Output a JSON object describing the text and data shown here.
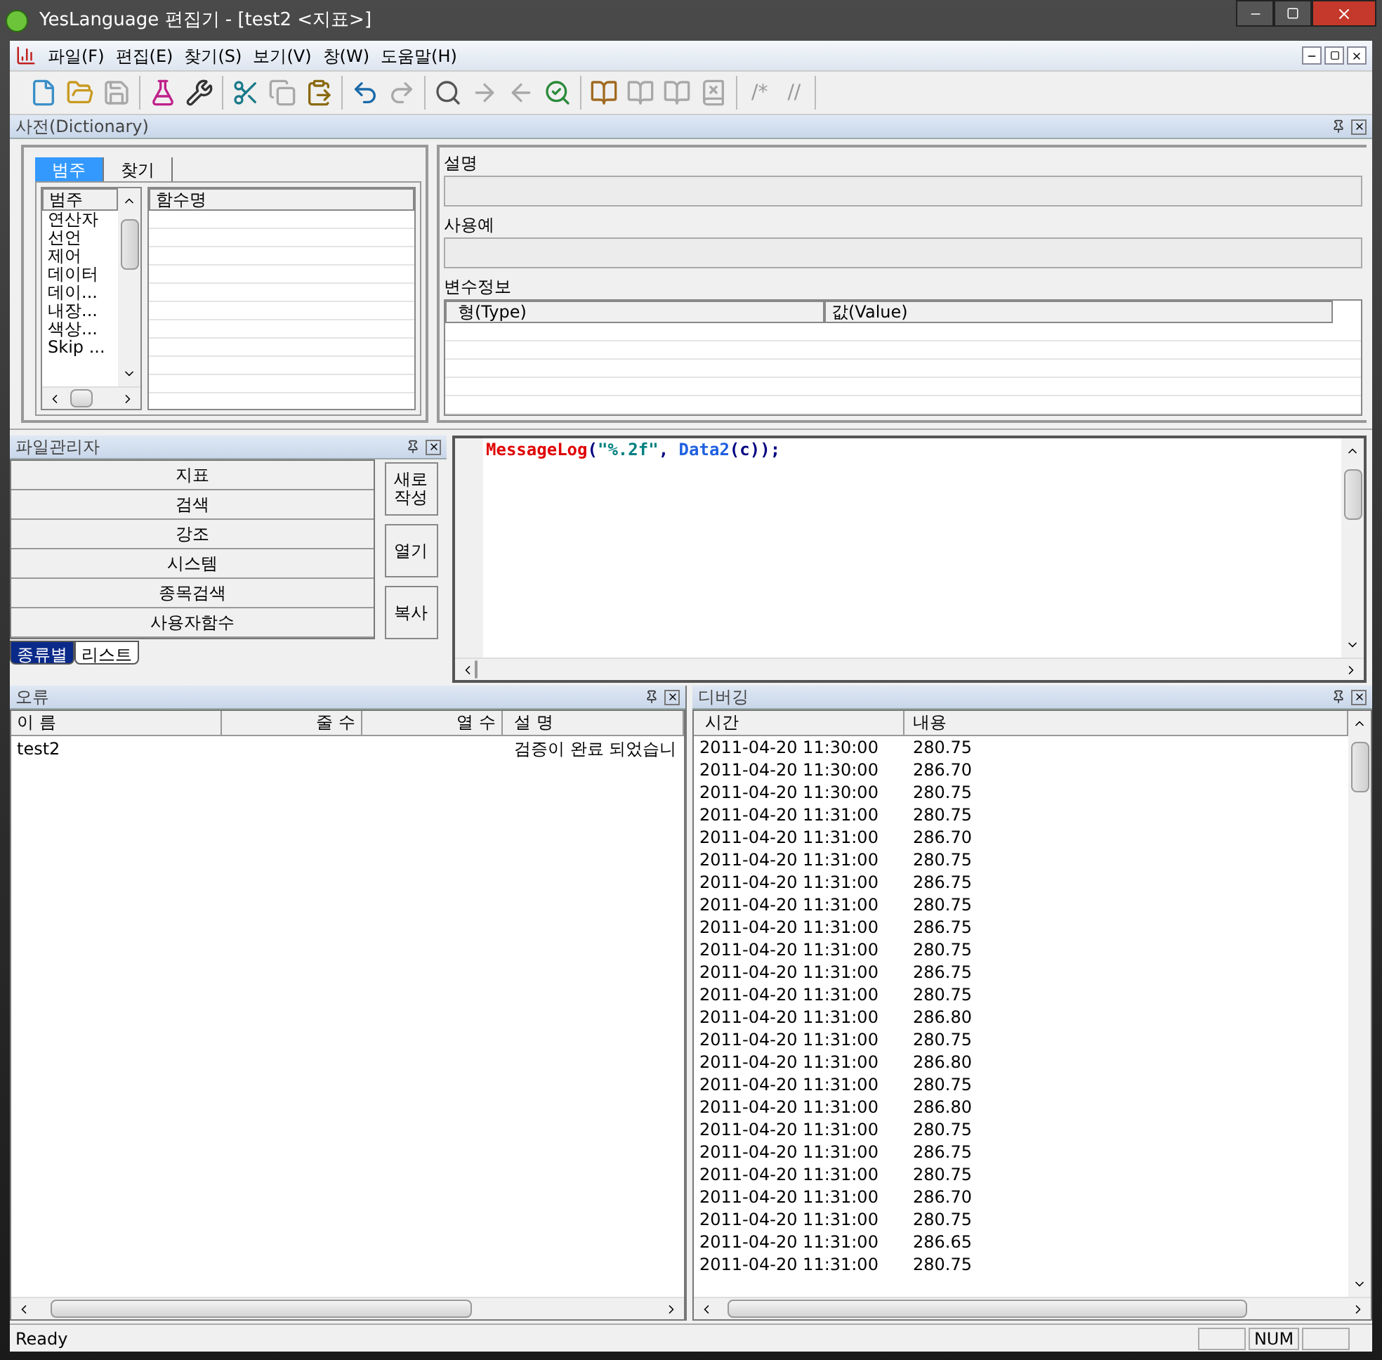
{
  "window": {
    "title": "YesLanguage 편집기 - [test2 <지표>]"
  },
  "menu": [
    "파일(F)",
    "편집(E)",
    "찾기(S)",
    "보기(V)",
    "창(W)",
    "도움말(H)"
  ],
  "toolbar": [
    [
      {
        "kind": "new",
        "disabled": false
      },
      {
        "kind": "open",
        "disabled": false
      },
      {
        "kind": "save",
        "disabled": true
      }
    ],
    [
      {
        "kind": "beaker",
        "disabled": false
      },
      {
        "kind": "tools",
        "disabled": false
      }
    ],
    [
      {
        "kind": "cut",
        "disabled": false
      },
      {
        "kind": "copy",
        "disabled": true
      },
      {
        "kind": "paste",
        "disabled": false
      }
    ],
    [
      {
        "kind": "undo",
        "disabled": false
      },
      {
        "kind": "redo",
        "disabled": true
      }
    ],
    [
      {
        "kind": "find",
        "disabled": false
      },
      {
        "kind": "next",
        "disabled": true
      },
      {
        "kind": "prev",
        "disabled": true
      },
      {
        "kind": "replace",
        "disabled": false
      }
    ],
    [
      {
        "kind": "book",
        "disabled": false
      },
      {
        "kind": "book",
        "disabled": true
      },
      {
        "kind": "book",
        "disabled": true
      },
      {
        "kind": "book-x",
        "disabled": true
      }
    ],
    [
      {
        "kind": "text",
        "label": "/*",
        "disabled": true
      },
      {
        "kind": "text",
        "label": "//",
        "disabled": true
      }
    ]
  ],
  "dictionary": {
    "title": "사전(Dictionary)",
    "tabs": [
      {
        "label": "범주",
        "selected": true
      },
      {
        "label": "찾기",
        "selected": false
      }
    ],
    "category_header": "범주",
    "categories": [
      "연산자",
      "선언",
      "제어",
      "데이터",
      "데이...",
      "내장...",
      "색상...",
      "Skip ..."
    ],
    "function_header": "함수명",
    "description_label": "설명",
    "example_label": "사용예",
    "variables_label": "변수정보",
    "variable_columns": [
      "형(Type)",
      "값(Value)"
    ]
  },
  "file_manager": {
    "title": "파일관리자",
    "items": [
      "지표",
      "검색",
      "강조",
      "시스템",
      "종목검색",
      "사용자함수"
    ],
    "buttons": [
      "새로\n작성",
      "열기",
      "복사"
    ],
    "tabs": [
      {
        "label": "종류별",
        "selected": true
      },
      {
        "label": "리스트",
        "selected": false
      }
    ]
  },
  "editor": {
    "tokens": [
      {
        "kind": "function",
        "text": "MessageLog"
      },
      {
        "kind": "punct",
        "text": "("
      },
      {
        "kind": "string",
        "text": "\"%.2f\""
      },
      {
        "kind": "punct",
        "text": ", "
      },
      {
        "kind": "identifier",
        "text": "Data2"
      },
      {
        "kind": "punct",
        "text": "(c));"
      }
    ]
  },
  "errors": {
    "title": "오류",
    "columns": [
      "이 름",
      "줄 수",
      "열 수",
      "설 명"
    ],
    "rows": [
      [
        "test2",
        "",
        "",
        "검증이 완료 되었습니"
      ]
    ]
  },
  "debug": {
    "title": "디버깅",
    "columns": [
      "시간",
      "내용"
    ],
    "rows": [
      [
        "2011-04-20 11:30:00",
        "280.75"
      ],
      [
        "2011-04-20 11:30:00",
        "286.70"
      ],
      [
        "2011-04-20 11:30:00",
        "280.75"
      ],
      [
        "2011-04-20 11:31:00",
        "280.75"
      ],
      [
        "2011-04-20 11:31:00",
        "286.70"
      ],
      [
        "2011-04-20 11:31:00",
        "280.75"
      ],
      [
        "2011-04-20 11:31:00",
        "286.75"
      ],
      [
        "2011-04-20 11:31:00",
        "280.75"
      ],
      [
        "2011-04-20 11:31:00",
        "286.75"
      ],
      [
        "2011-04-20 11:31:00",
        "280.75"
      ],
      [
        "2011-04-20 11:31:00",
        "286.75"
      ],
      [
        "2011-04-20 11:31:00",
        "280.75"
      ],
      [
        "2011-04-20 11:31:00",
        "286.80"
      ],
      [
        "2011-04-20 11:31:00",
        "280.75"
      ],
      [
        "2011-04-20 11:31:00",
        "286.80"
      ],
      [
        "2011-04-20 11:31:00",
        "280.75"
      ],
      [
        "2011-04-20 11:31:00",
        "286.80"
      ],
      [
        "2011-04-20 11:31:00",
        "280.75"
      ],
      [
        "2011-04-20 11:31:00",
        "286.75"
      ],
      [
        "2011-04-20 11:31:00",
        "280.75"
      ],
      [
        "2011-04-20 11:31:00",
        "286.70"
      ],
      [
        "2011-04-20 11:31:00",
        "280.75"
      ],
      [
        "2011-04-20 11:31:00",
        "286.65"
      ],
      [
        "2011-04-20 11:31:00",
        "280.75"
      ]
    ]
  },
  "status_bar": {
    "message": "Ready",
    "indicator": "NUM"
  }
}
